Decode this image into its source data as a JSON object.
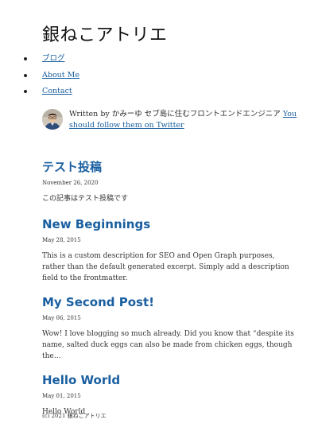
{
  "site": {
    "title": "銀ねこアトリエ"
  },
  "nav": {
    "items": [
      {
        "label": "ブログ"
      },
      {
        "label": "About Me"
      },
      {
        "label": "Contact"
      }
    ]
  },
  "bio": {
    "text": "Written by かみーゆ セブ島に住むフロントエンドエンジニア",
    "link_label": "You should follow them on Twitter"
  },
  "posts": [
    {
      "title": "テスト投稿",
      "date": "November 26, 2020",
      "excerpt": "この記事はテスト投稿です"
    },
    {
      "title": "New Beginnings",
      "date": "May 28, 2015",
      "excerpt": "This is a custom description for SEO and Open Graph purposes, rather than the default generated excerpt. Simply add a description field to the frontmatter."
    },
    {
      "title": "My Second Post!",
      "date": "May 06, 2015",
      "excerpt": "Wow! I love blogging so much already. Did you know that “despite its name, salted duck eggs can also be made from chicken eggs, though the…"
    },
    {
      "title": "Hello World",
      "date": "May 01, 2015",
      "excerpt": "Hello World"
    }
  ],
  "footer": {
    "text": "(c) 2021 銀ねこアトリエ"
  },
  "colors": {
    "link": "#1a5fa0",
    "text": "#2b2b2b",
    "title": "#111111"
  }
}
